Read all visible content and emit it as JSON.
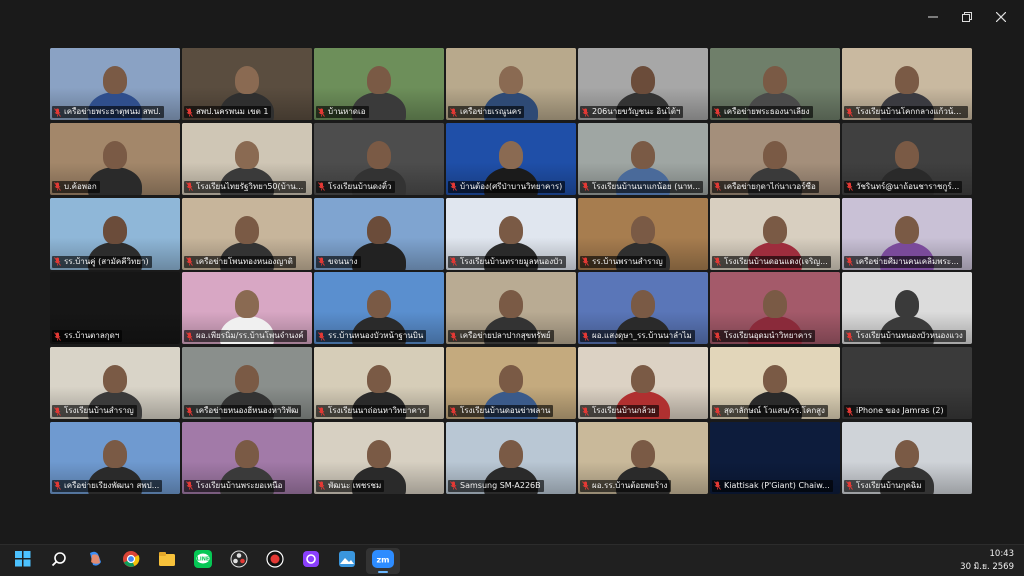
{
  "window": {
    "controls": [
      "minimize",
      "maximize",
      "close"
    ]
  },
  "participants": [
    {
      "name": "เครือข่ายพระธาตุพนม สพป.",
      "bg": "#8aa2c4",
      "skin": "#7a5a45",
      "shirt": "#2f4e8c"
    },
    {
      "name": "สพป.นครพนม เขต 1",
      "bg": "#5a4d3f",
      "skin": "#8a6a52",
      "shirt": "#2f2f2f",
      "active": true
    },
    {
      "name": "บ้านหาดเอ",
      "bg": "#6d8f5a",
      "skin": "#7a5a45",
      "shirt": "#3a3a3a"
    },
    {
      "name": "เครือข่ายเรณูนคร",
      "bg": "#b8a98c",
      "skin": "#8a6a52",
      "shirt": "#2e4a75"
    },
    {
      "name": "206นายขวัญชนะ อินไต้ฯ",
      "bg": "#a7a7a7",
      "skin": "#6b4c3a",
      "shirt": "#333"
    },
    {
      "name": "เครือข่ายพระธองนาเลียง",
      "bg": "#6f7f6a",
      "skin": "#7a5a45",
      "shirt": "#4a4a4a"
    },
    {
      "name": "โรงเรียนบ้านโคกกลางแก้วน้อยฯ",
      "bg": "#c9b9a0",
      "skin": "#7a5a45",
      "shirt": "#3a3a40"
    },
    {
      "name": "บ.ค้อพอก",
      "bg": "#a3876a",
      "skin": "#7a5a45",
      "shirt": "#2a2a2a"
    },
    {
      "name": "โรงเรียนไทยรัฐวิทยา50(บ้าน...",
      "bg": "#cfc6b5",
      "skin": "#8a6a52",
      "shirt": "#3a3a3a"
    },
    {
      "name": "โรงเรียนบ้านดงติ้ว",
      "bg": "#4d4d4d",
      "skin": "#7a5a45",
      "shirt": "#333"
    },
    {
      "name": "บ้านต้อง(ศรีป่าบานวิทยาคาร)",
      "bg": "#1f4fa8",
      "skin": "#8a6a52",
      "shirt": "#1b1b1b"
    },
    {
      "name": "โรงเรียนบ้านนาแกน้อย (นาท...",
      "bg": "#9fa6a3",
      "skin": "#7a5a45",
      "shirt": "#4a6a9a"
    },
    {
      "name": "เครือข่ายกุดาไก่นาเวอร์ซือ",
      "bg": "#a48f7b",
      "skin": "#7a5a45",
      "shirt": "#3a3a3a"
    },
    {
      "name": "วัชรินทร์@นาถ้อนชาราชกูร์...",
      "bg": "#404040",
      "skin": "#7a5a45",
      "shirt": "#2a2a2a"
    },
    {
      "name": "รร.บ้านคู่ (สามัคคีวิทยา)",
      "bg": "#8fb7d8",
      "skin": "#6b4c3a",
      "shirt": "#2c2c2c"
    },
    {
      "name": "เครือข่ายโพนทองหนองญาติ",
      "bg": "#c7b59b",
      "skin": "#7a5a45",
      "shirt": "#333"
    },
    {
      "name": "ขจนนาง",
      "bg": "#7fa4d0",
      "skin": "#6b4c3a",
      "shirt": "#222"
    },
    {
      "name": "โรงเรียนบ้านทรายมูลหนองบัว",
      "bg": "#e0e6ef",
      "skin": "#7a5a45",
      "shirt": "#2a2a2a"
    },
    {
      "name": "รร.บ้านพรานสำราญ",
      "bg": "#a77d4f",
      "skin": "#7a5a45",
      "shirt": "#2f2f2f"
    },
    {
      "name": "โรงเรียนบ้านดอนแดง(เจริญ...",
      "bg": "#d8cfc0",
      "skin": "#7a5a45",
      "shirt": "#9e2d3d"
    },
    {
      "name": "เครือข่ายศีมานคนเคลิมพระ...",
      "bg": "#c9c1d6",
      "skin": "#7a5a45",
      "shirt": "#7a4a9a"
    },
    {
      "name": "รร.บ้านตาลกุดฯ",
      "bg": "#161616",
      "skin": "#161616",
      "shirt": "#161616"
    },
    {
      "name": "ผอ.เพียรนิ่ม/รร.บ้านโพนจำนงค์",
      "bg": "#d8a7c4",
      "skin": "#8a6a52",
      "shirt": "#f0f0f0"
    },
    {
      "name": "รร.บ้านหนองบัวหน้าฐานบิน",
      "bg": "#5a8fcf",
      "skin": "#7a5a45",
      "shirt": "#2a2a2a"
    },
    {
      "name": "เครือข่ายปลาปากสุขทรัพย์",
      "bg": "#b9ab93",
      "skin": "#7a5a45",
      "shirt": "#333"
    },
    {
      "name": "ผอ.แสงดุษา_รร.บ้านนาลำไม",
      "bg": "#5a76b8",
      "skin": "#7a5a45",
      "shirt": "#2a2a2a"
    },
    {
      "name": "โรงเรียนอุดมนำวิทยาคาร",
      "bg": "#a45a6a",
      "skin": "#7a5a45",
      "shirt": "#8a2a3a"
    },
    {
      "name": "โรงเรียนบ้านหนองบัวหนองแวง",
      "bg": "#dcdcdc",
      "skin": "#3a3a3a",
      "shirt": "#3a3a3a"
    },
    {
      "name": "โรงเรียนบ้านสำราญ",
      "bg": "#d9d4c8",
      "skin": "#7a5a45",
      "shirt": "#3a3a3a"
    },
    {
      "name": "เครือข่ายหนองฮีหนองหาวิพัฒ",
      "bg": "#8a8f8c",
      "skin": "#7a5a45",
      "shirt": "#333"
    },
    {
      "name": "โรงเรียนนาถ่อนหาวิทยาคาร",
      "bg": "#d6cdb8",
      "skin": "#7a5a45",
      "shirt": "#2a2a2a"
    },
    {
      "name": "โรงเรียนบ้านดอนข่าพลาน",
      "bg": "#c4aa7e",
      "skin": "#7a5a45",
      "shirt": "#3a5a8a"
    },
    {
      "name": "โรงเรียนบ้านกล้วย",
      "bg": "#dcd2c4",
      "skin": "#7a5a45",
      "shirt": "#b03030"
    },
    {
      "name": "สุดาลักษณ์ โวแสน/รร.โคกสูง",
      "bg": "#e2d6ba",
      "skin": "#7a5a45",
      "shirt": "#2a2a2a"
    },
    {
      "name": "iPhone ของ Jamras (2)",
      "bg": "#3a3a3a",
      "skin": "#3a3a3a",
      "shirt": "#3a3a3a"
    },
    {
      "name": "เครือข่ายเรียงพัฒนา สพป...",
      "bg": "#6f9ad0",
      "skin": "#7a5a45",
      "shirt": "#2a2a2a"
    },
    {
      "name": "โรงเรียนบ้านพระยอเหนือ",
      "bg": "#a27aa8",
      "skin": "#7a5a45",
      "shirt": "#3a3a3a"
    },
    {
      "name": "พัฒนะ เพชรชม",
      "bg": "#d7d0c2",
      "skin": "#7a5a45",
      "shirt": "#2a2a2a"
    },
    {
      "name": "Samsung SM-A226B",
      "bg": "#b9c7d4",
      "skin": "#7a5a45",
      "shirt": "#2a2a2a"
    },
    {
      "name": "ผอ.รร.บ้านต้อยพยร้าง",
      "bg": "#c9b99a",
      "skin": "#7a5a45",
      "shirt": "#2a2a2a"
    },
    {
      "name": "Kiattisak (P'Giant) Chaiw...",
      "bg": "#0d1c3c",
      "skin": "#0d1c3c",
      "shirt": "#0d1c3c"
    },
    {
      "name": "โรงเรียนบ้านกุดฉิม",
      "bg": "#cfd3d8",
      "skin": "#7a5a45",
      "shirt": "#333"
    }
  ],
  "taskbar": {
    "apps": [
      {
        "icon": "windows-start-icon",
        "color": "#4cc2ff"
      },
      {
        "icon": "search-icon",
        "color": "#ffffff"
      },
      {
        "icon": "copilot-icon",
        "color": "#ff8c5a"
      },
      {
        "icon": "chrome-icon",
        "color": "#f4c20d"
      },
      {
        "icon": "file-explorer-icon",
        "color": "#f8c23b"
      },
      {
        "icon": "line-app-icon",
        "color": "#06c755"
      },
      {
        "icon": "obs-icon",
        "color": "#e0e0e0"
      },
      {
        "icon": "record-icon",
        "color": "#e53935"
      },
      {
        "icon": "pdf-app-icon",
        "color": "#8a3ffc"
      },
      {
        "icon": "photos-icon",
        "color": "#3a96dd"
      },
      {
        "icon": "zoom-app-icon",
        "color": "#2d8cff",
        "active": true
      }
    ],
    "time": "10:43",
    "date": "30 มิ.ย. 2569",
    "zoom_label": "zm"
  }
}
